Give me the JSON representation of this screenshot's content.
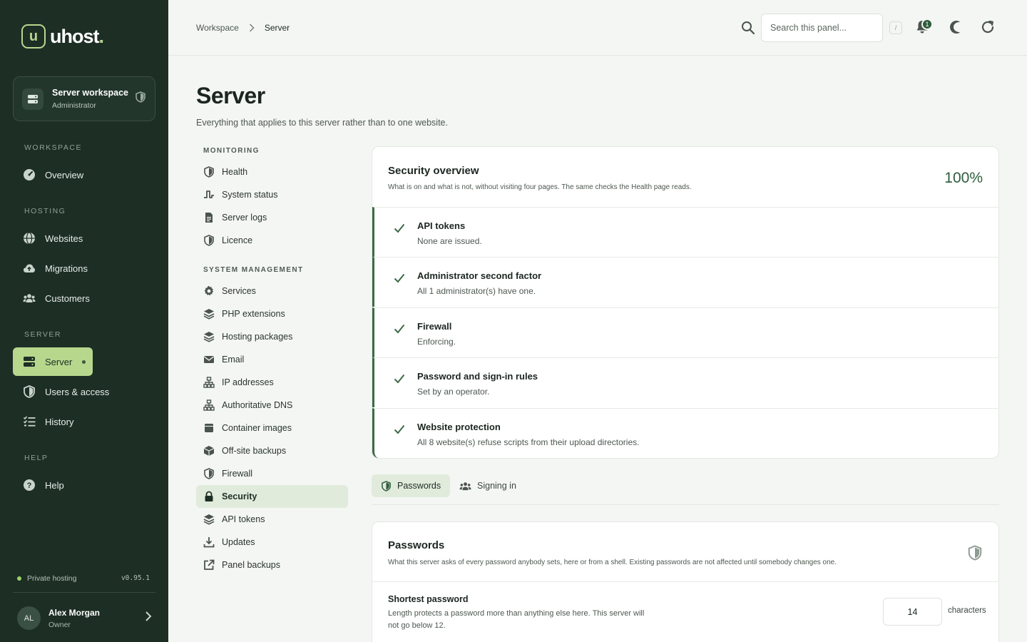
{
  "brand": {
    "name": "uhost",
    "dot": ".",
    "mark": "u"
  },
  "workspace": {
    "title": "Server workspace",
    "role": "Administrator"
  },
  "sidebar": {
    "sections": [
      {
        "label": "WORKSPACE",
        "items": [
          {
            "label": "Overview",
            "icon": "gauge-icon"
          }
        ]
      },
      {
        "label": "HOSTING",
        "items": [
          {
            "label": "Websites",
            "icon": "globe-icon"
          },
          {
            "label": "Migrations",
            "icon": "cloud-upload-icon"
          },
          {
            "label": "Customers",
            "icon": "users-icon"
          }
        ]
      },
      {
        "label": "SERVER",
        "items": [
          {
            "label": "Server",
            "icon": "server-icon",
            "active": true
          },
          {
            "label": "Users & access",
            "icon": "shield-icon"
          },
          {
            "label": "History",
            "icon": "list-check-icon"
          }
        ]
      },
      {
        "label": "HELP",
        "items": [
          {
            "label": "Help",
            "icon": "help-circle-icon"
          }
        ]
      }
    ],
    "footer": {
      "hosting_label": "Private hosting",
      "version": "v0.95.1"
    },
    "user": {
      "initials": "AL",
      "name": "Alex Morgan",
      "role": "Owner"
    }
  },
  "topbar": {
    "breadcrumb": [
      "Workspace",
      "Server"
    ],
    "search_placeholder": "Search this panel...",
    "shortcut": "/",
    "notification_count": "1"
  },
  "page": {
    "title": "Server",
    "subtitle": "Everything that applies to this server rather than to one website."
  },
  "subnav": {
    "sections": [
      {
        "label": "MONITORING",
        "items": [
          {
            "label": "Health",
            "icon": "shield-half-icon"
          },
          {
            "label": "System status",
            "icon": "pulse-icon"
          },
          {
            "label": "Server logs",
            "icon": "file-text-icon"
          },
          {
            "label": "Licence",
            "icon": "shield-half-icon"
          }
        ]
      },
      {
        "label": "SYSTEM MANAGEMENT",
        "items": [
          {
            "label": "Services",
            "icon": "gear-icon"
          },
          {
            "label": "PHP extensions",
            "icon": "layers-icon"
          },
          {
            "label": "Hosting packages",
            "icon": "layers-icon"
          },
          {
            "label": "Email",
            "icon": "envelope-icon"
          },
          {
            "label": "IP addresses",
            "icon": "network-icon"
          },
          {
            "label": "Authoritative DNS",
            "icon": "network-icon"
          },
          {
            "label": "Container images",
            "icon": "box-icon"
          },
          {
            "label": "Off-site backups",
            "icon": "box-open-icon"
          },
          {
            "label": "Firewall",
            "icon": "shield-half-icon"
          },
          {
            "label": "Security",
            "icon": "lock-icon",
            "active": true
          },
          {
            "label": "API tokens",
            "icon": "layers-icon"
          },
          {
            "label": "Updates",
            "icon": "download-icon"
          },
          {
            "label": "Panel backups",
            "icon": "external-link-icon"
          }
        ]
      }
    ]
  },
  "security_overview": {
    "title": "Security overview",
    "description": "What is on and what is not, without visiting four pages. The same checks the Health page reads.",
    "score": "100%",
    "checks": [
      {
        "title": "API tokens",
        "detail": "None are issued."
      },
      {
        "title": "Administrator second factor",
        "detail": "All 1 administrator(s) have one."
      },
      {
        "title": "Firewall",
        "detail": "Enforcing."
      },
      {
        "title": "Password and sign-in rules",
        "detail": "Set by an operator."
      },
      {
        "title": "Website protection",
        "detail": "All 8 website(s) refuse scripts from their upload directories."
      }
    ]
  },
  "tabs": [
    {
      "label": "Passwords",
      "icon": "shield-half-icon",
      "active": true
    },
    {
      "label": "Signing in",
      "icon": "users-icon"
    }
  ],
  "passwords": {
    "title": "Passwords",
    "description": "What this server asks of every password anybody sets, here or from a shell. Existing passwords are not affected until somebody changes one.",
    "shortest": {
      "label": "Shortest password",
      "help": "Length protects a password more than anything else here. This server will not go below 12.",
      "value": "14",
      "unit": "characters"
    }
  },
  "colors": {
    "sidebar_bg": "#1d2e25",
    "accent": "#b7d78d",
    "brand_green": "#2e5c3c",
    "page_bg": "#f4f6f3"
  }
}
